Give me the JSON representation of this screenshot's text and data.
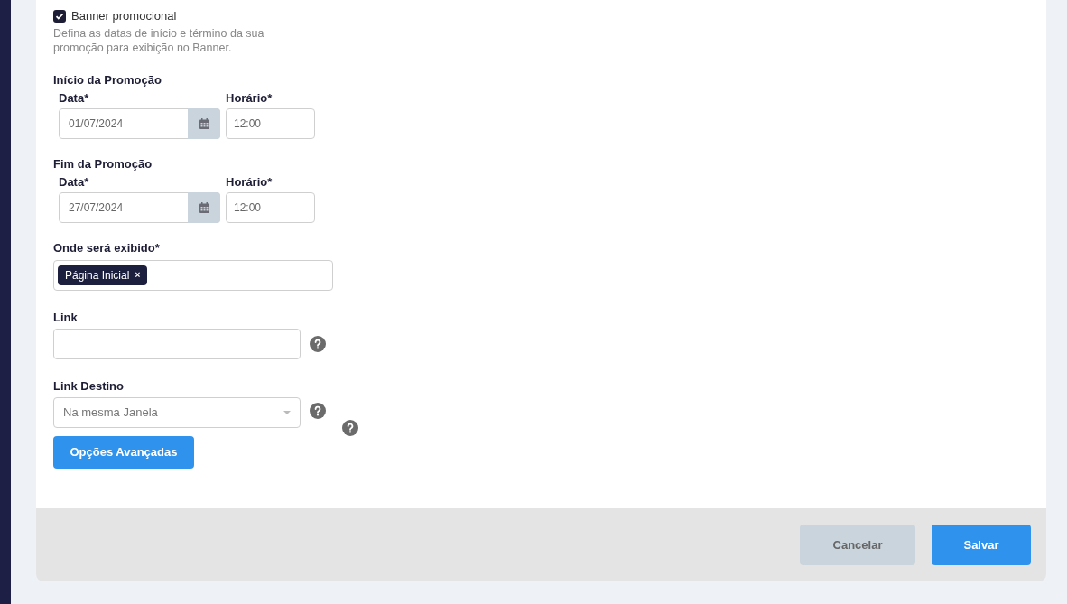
{
  "banner": {
    "label": "Banner promocional",
    "checked": true,
    "description": "Defina as datas de início e término da sua promoção para exibição no Banner."
  },
  "periods": [
    {
      "title": "Início da Promoção",
      "date_label": "Data*",
      "date": "01/07/2024",
      "time_label": "Horário*",
      "time": "12:00"
    },
    {
      "title": "Fim da Promoção",
      "date_label": "Data*",
      "date": "27/07/2024",
      "time_label": "Horário*",
      "time": "12:00"
    }
  ],
  "display": {
    "label": "Onde será exibido*",
    "tags": [
      "Página Inicial"
    ],
    "tag_remove": "×"
  },
  "link": {
    "label": "Link"
  },
  "link_target": {
    "label": "Link Destino",
    "value": "Na mesma Janela"
  },
  "advanced_button": "Opções Avançadas",
  "footer": {
    "cancel": "Cancelar",
    "save": "Salvar"
  }
}
